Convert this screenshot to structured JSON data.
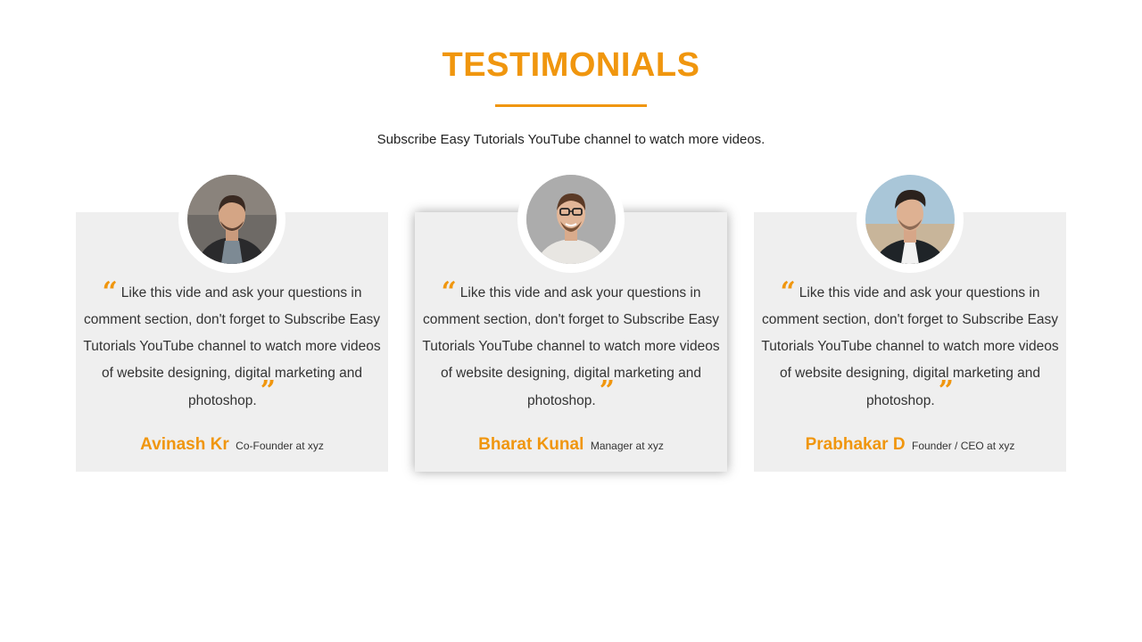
{
  "header": {
    "title": "TESTIMONIALS",
    "subtitle": "Subscribe Easy Tutorials YouTube channel to watch more videos."
  },
  "colors": {
    "accent": "#f0960e",
    "card_background": "#efefef"
  },
  "testimonials": [
    {
      "quote": "Like this vide and ask your questions in comment section, don't forget to Subscribe Easy Tutorials YouTube channel to watch more videos of website designing, digital marketing and photoshop.",
      "name": "Avinash Kr",
      "role": "Co-Founder at xyz",
      "avatar_icon": "user-photo-icon"
    },
    {
      "quote": "Like this vide and ask your questions in comment section, don't forget to Subscribe Easy Tutorials YouTube channel to watch more videos of website designing, digital marketing and photoshop.",
      "name": "Bharat Kunal",
      "role": "Manager at xyz",
      "avatar_icon": "user-photo-icon"
    },
    {
      "quote": "Like this vide and ask your questions in comment section, don't forget to Subscribe Easy Tutorials YouTube channel to watch more videos of website designing, digital marketing and photoshop.",
      "name": "Prabhakar D",
      "role": "Founder / CEO at xyz",
      "avatar_icon": "user-photo-icon"
    }
  ]
}
